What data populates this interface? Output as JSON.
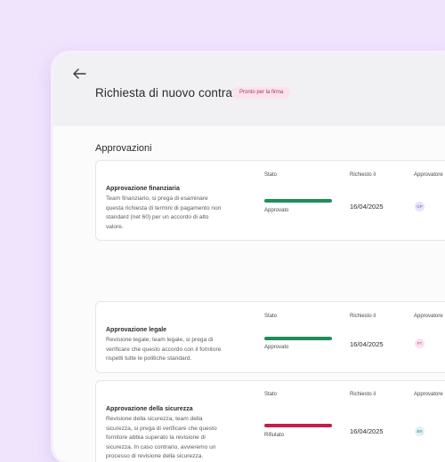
{
  "header": {
    "title": "Richiesta di nuovo contratto",
    "status_badge": "Pronto per la firma"
  },
  "section": {
    "title": "Approvazioni"
  },
  "columns": {
    "status": "Stato",
    "requested": "Richiesto il",
    "approver": "Approvatore"
  },
  "approvals": [
    {
      "title": "Approvazione finanziaria",
      "description": "Team finanziario, si prega di esaminare questa richiesta di termini di pagamento non standard (net 60) per un accordo di alto valore.",
      "status_label": "Approvato",
      "status_color": "#1e8d57",
      "date": "16/04/2025",
      "approver_initials": "GP",
      "approver_bg": "#e6e3fb",
      "approver_fg": "#6b5bb8"
    },
    {
      "title": "Approvazione legale",
      "description": "Revisione legale, team legale, si prega di verificare che questo accordo con il fornitore rispetti tutte le politiche standard.",
      "status_label": "Approvato",
      "status_color": "#1e8d57",
      "date": "16/04/2025",
      "approver_initials": "FT",
      "approver_bg": "#fbe0ee",
      "approver_fg": "#b0457a"
    },
    {
      "title": "Approvazione della sicurezza",
      "description": "Revisione della sicurezza, team della sicurezza, si prega di verificare che questo fornitore abbia superato la revisione di sicurezza. In caso contrario, avvieremo un processo di revisione della sicurezza.",
      "status_label": "Rifiutato",
      "status_color": "#c21f4a",
      "date": "16/04/2025",
      "approver_initials": "BR",
      "approver_bg": "#dff1f3",
      "approver_fg": "#3f8790"
    }
  ]
}
